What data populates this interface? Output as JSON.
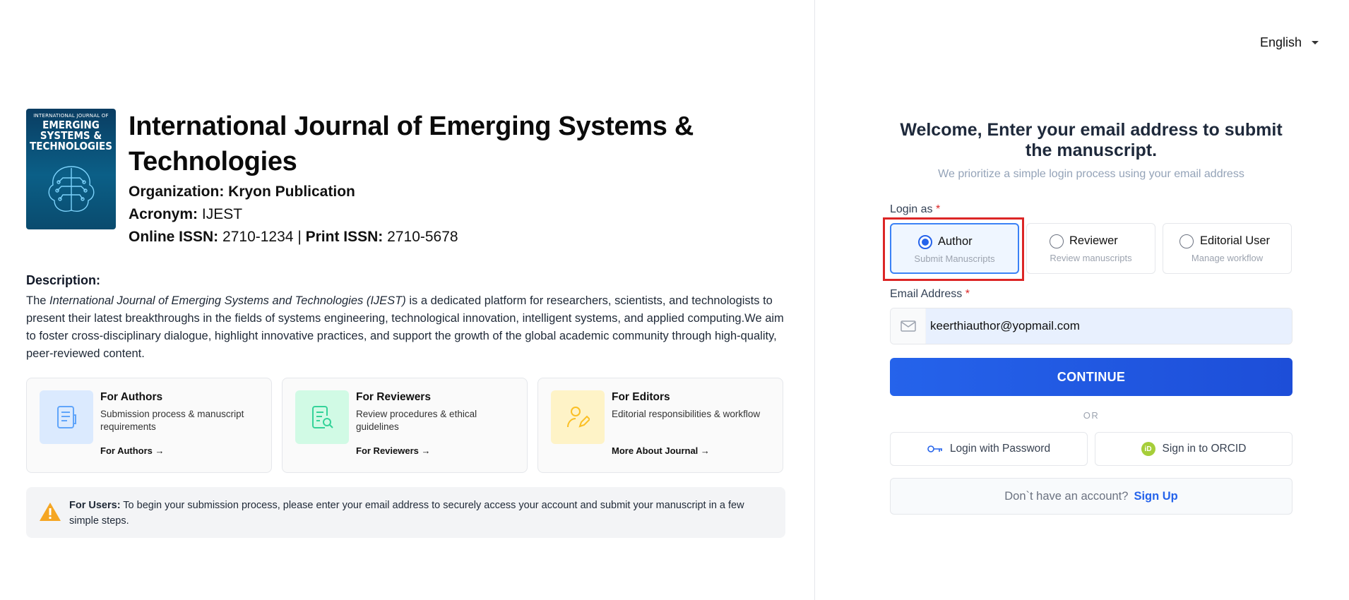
{
  "journal": {
    "cover_top": "INTERNATIONAL JOURNAL OF",
    "cover_line1": "EMERGING",
    "cover_line2": "SYSTEMS &",
    "cover_line3": "TECHNOLOGIES",
    "title": "International Journal of Emerging Systems & Technologies",
    "organization": "Organization: Kryon Publication",
    "acronym_label": "Acronym:",
    "acronym_value": "IJEST",
    "online_issn_label": "Online ISSN:",
    "online_issn_value": "2710-1234",
    "separator": "|",
    "print_issn_label": "Print ISSN:",
    "print_issn_value": "2710-5678"
  },
  "description": {
    "heading": "Description:",
    "prefix": "The ",
    "italic": "International Journal of Emerging Systems and Technologies (IJEST)",
    "body": " is a dedicated platform for researchers, scientists, and technologists to present their latest breakthroughs in the fields of systems engineering, technological innovation, intelligent systems, and applied computing.We aim to foster cross-disciplinary dialogue, highlight innovative practices, and support the growth of the global academic community through high-quality, peer-reviewed content."
  },
  "cards": [
    {
      "title": "For Authors",
      "subtitle": "Submission process & manuscript requirements",
      "link": "For Authors →",
      "icon": "document-icon",
      "color": "#dbeafe"
    },
    {
      "title": "For Reviewers",
      "subtitle": "Review procedures & ethical guidelines",
      "link": "For Reviewers →",
      "icon": "document-search-icon",
      "color": "#d1fae5"
    },
    {
      "title": "For Editors",
      "subtitle": "Editorial responsibilities & workflow",
      "link": "More About Journal →",
      "icon": "user-edit-icon",
      "color": "#fef3c7"
    }
  ],
  "notice": {
    "label": "For Users:",
    "text": " To begin your submission process, please enter your email address to securely access your account and submit your manuscript in a few simple steps."
  },
  "language": {
    "selected": "English"
  },
  "login": {
    "welcome": "Welcome, Enter your email address to submit the manuscript.",
    "subtitle": "We prioritize a simple login process using your email address",
    "login_as_label": "Login as",
    "required_mark": "*",
    "roles": [
      {
        "label": "Author",
        "sub": "Submit Manuscripts",
        "selected": true
      },
      {
        "label": "Reviewer",
        "sub": "Review manuscripts",
        "selected": false
      },
      {
        "label": "Editorial User",
        "sub": "Manage workflow",
        "selected": false
      }
    ],
    "email_label": "Email Address",
    "email_value": "keerthiauthor@yopmail.com",
    "continue_label": "CONTINUE",
    "or_label": "OR",
    "password_login_label": "Login with Password",
    "orcid_label": "Sign in to ORCID",
    "orcid_badge": "iD",
    "no_account_text": "Don`t have an account?",
    "signup_label": "Sign Up"
  },
  "colors": {
    "primary": "#2563eb",
    "highlight_box": "#dc2626",
    "selected_bg": "#eff6ff"
  }
}
